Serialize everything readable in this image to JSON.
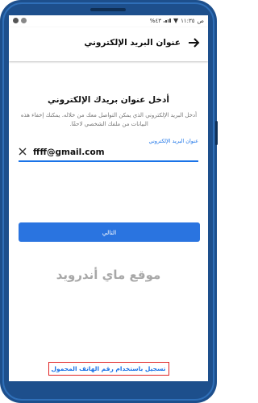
{
  "status_bar": {
    "carrier": "ص",
    "time": "١١:٣٥",
    "battery": "%٤٣"
  },
  "app_bar": {
    "title": "عنوان البريد الإلكتروني"
  },
  "form": {
    "heading": "أدخل عنوان بريدك الإلكتروني",
    "description": "أدخل البريد الإلكتروني الذي يمكن التواصل معك من خلاله. يمكنك إخفاء هذه البيانات من ملفك الشخصي لاحقًا.",
    "field_label": "عنوان البريد الإلكتروني",
    "email_value": "ffff@gmail.com",
    "next_label": "التالي"
  },
  "watermark": "موقع ماي أندرويد",
  "phone_link": "تسجيل باستخدام رقم الهاتف المحمول",
  "colors": {
    "accent": "#1a73e8",
    "button": "#2a74e0",
    "phone_frame": "#1d4f8c",
    "highlight_box": "#e02424"
  },
  "icons": {
    "back": "arrow-right-icon",
    "clear": "close-icon"
  }
}
